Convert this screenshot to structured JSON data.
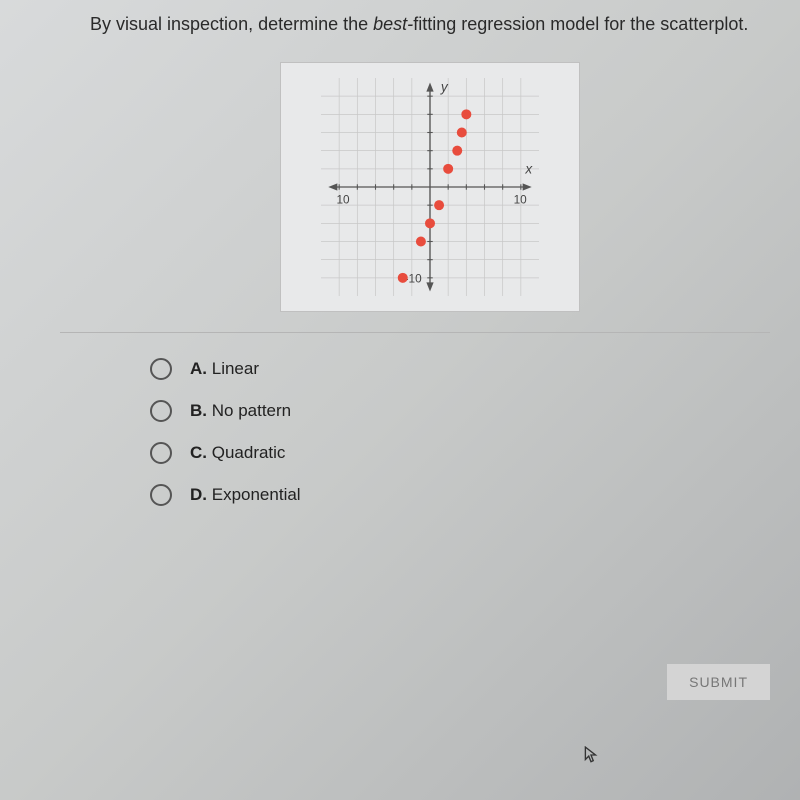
{
  "question": {
    "prefix": "By visual inspection, determine the ",
    "italic": "best-",
    "suffix": "fitting regression model for the scatterplot."
  },
  "options": [
    {
      "letter": "A.",
      "text": "Linear"
    },
    {
      "letter": "B.",
      "text": "No pattern"
    },
    {
      "letter": "C.",
      "text": "Quadratic"
    },
    {
      "letter": "D.",
      "text": "Exponential"
    }
  ],
  "submit_label": "SUBMIT",
  "chart_data": {
    "type": "scatter",
    "title": "",
    "xlabel": "x",
    "ylabel": "y",
    "xlim": [
      -10,
      10
    ],
    "ylim": [
      -12,
      10
    ],
    "x_ticks": [
      -10,
      10
    ],
    "y_ticks": [
      -10
    ],
    "grid": true,
    "points": [
      {
        "x": -3,
        "y": -10
      },
      {
        "x": -1,
        "y": -6
      },
      {
        "x": 0,
        "y": -4
      },
      {
        "x": 1,
        "y": -2
      },
      {
        "x": 2,
        "y": 2
      },
      {
        "x": 3,
        "y": 4
      },
      {
        "x": 3.5,
        "y": 6
      },
      {
        "x": 4,
        "y": 8
      }
    ],
    "x_tick_labels": {
      "neg": "10",
      "pos": "10"
    },
    "y_tick_label_neg": "-10"
  }
}
